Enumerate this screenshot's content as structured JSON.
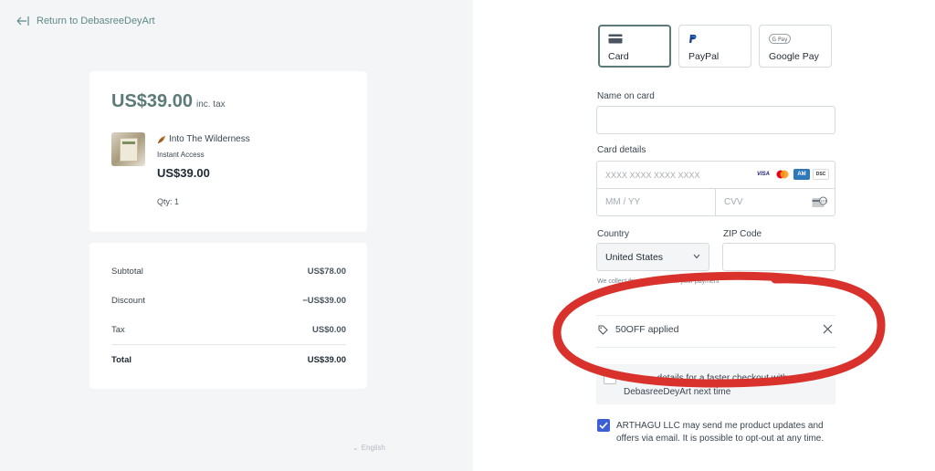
{
  "left": {
    "back_link": "Return to DebasreeDeyArt",
    "summary": {
      "price": "US$39.00",
      "tax_note": "inc. tax",
      "product_name": "Into The Wilderness",
      "product_access": "Instant Access",
      "product_price": "US$39.00",
      "qty": "Qty: 1"
    },
    "totals": [
      {
        "label": "Subtotal",
        "value": "US$78.00"
      },
      {
        "label": "Discount",
        "value": "−US$39.00"
      },
      {
        "label": "Tax",
        "value": "US$0.00"
      }
    ],
    "total": {
      "label": "Total",
      "value": "US$39.00"
    },
    "language": "English"
  },
  "right": {
    "payment_methods": [
      {
        "label": "Card",
        "icon": "card-icon",
        "active": true
      },
      {
        "label": "PayPal",
        "icon": "paypal-icon",
        "active": false
      },
      {
        "label": "Google Pay",
        "icon": "google-pay-icon",
        "active": false
      }
    ],
    "name_label": "Name on card",
    "card_label": "Card details",
    "card_number_placeholder": "XXXX XXXX XXXX XXXX",
    "card_brands": [
      "VISA",
      "mastercard",
      "amex",
      "discover"
    ],
    "exp_placeholder": "MM / YY",
    "cvv_placeholder": "CVV",
    "country_label": "Country",
    "country_value": "United States",
    "zip_label": "ZIP Code",
    "notice": "We collect this information ... your payment",
    "coupon": "50OFF applied",
    "save_text": "Save ... details for a faster checkout with DebasreeDeyArt next time",
    "optin_text": "ARTHAGU LLC may send me product updates and offers via email. It is possible to opt-out at any time."
  },
  "colors": {
    "accent": "#5c7a78",
    "checkbox": "#3c5fd6",
    "annotation_red": "#d9312b"
  }
}
